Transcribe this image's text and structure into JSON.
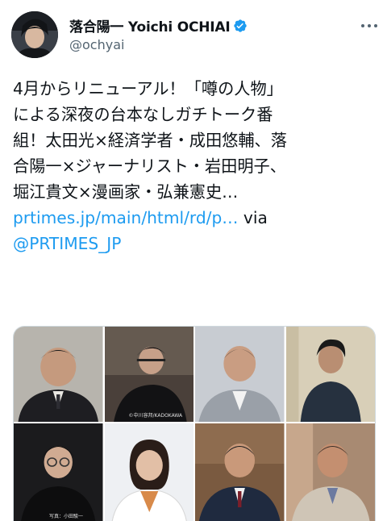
{
  "tweet": {
    "display_name": "落合陽一 Yoichi OCHIAI",
    "handle": "@ochyai",
    "lines": [
      "4月からリニューアル！「噂の人物」",
      "による深夜の台本なしガチトーク番",
      "組！太田光×経済学者・成田悠輔、落",
      "合陽一×ジャーナリスト・岩田明子、",
      "堀江貴文×漫画家・弘兼憲史…"
    ],
    "link_text": "prtimes.jp/main/html/rd/p…",
    "via_text": " via",
    "mention_text": "@PRTIMES_JP"
  },
  "media": {
    "credit_1": "©中川容邦/KADOKAWA",
    "credit_2": "写真：小田駿一"
  },
  "colors": {
    "link": "#1d9bf0",
    "verified": "#1d9bf0",
    "secondary_text": "#536471"
  },
  "icons": [
    "verified-badge-icon",
    "more-options-icon"
  ]
}
